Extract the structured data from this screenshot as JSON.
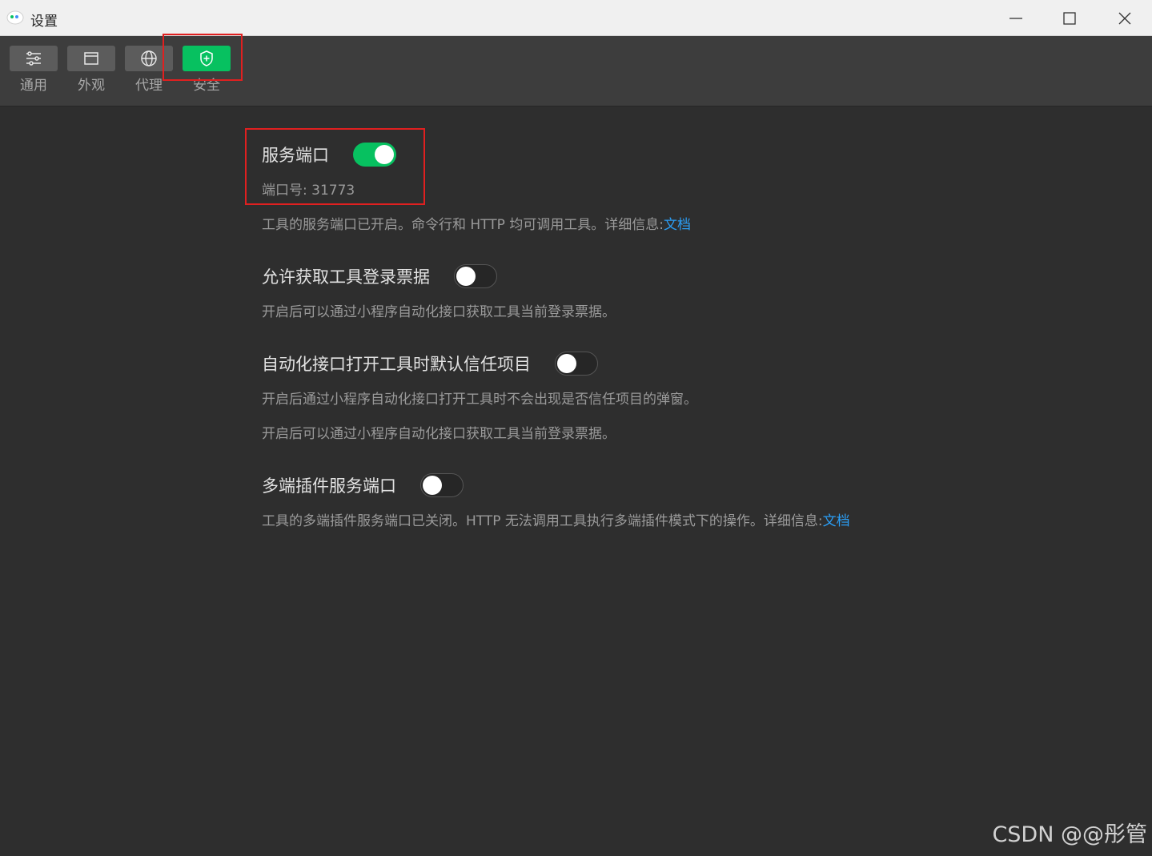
{
  "window": {
    "title": "设置"
  },
  "tabs": [
    {
      "label": "通用",
      "icon": "sliders-icon",
      "active": false
    },
    {
      "label": "外观",
      "icon": "window-icon",
      "active": false
    },
    {
      "label": "代理",
      "icon": "globe-icon",
      "active": false
    },
    {
      "label": "安全",
      "icon": "shield-plus-icon",
      "active": true
    }
  ],
  "settings": {
    "service_port": {
      "title": "服务端口",
      "enabled": true,
      "port_label": "端口号: 31773",
      "desc": "工具的服务端口已开启。命令行和 HTTP 均可调用工具。详细信息:",
      "link": "文档"
    },
    "login_ticket": {
      "title": "允许获取工具登录票据",
      "enabled": false,
      "desc": "开启后可以通过小程序自动化接口获取工具当前登录票据。"
    },
    "trust_project": {
      "title": "自动化接口打开工具时默认信任项目",
      "enabled": false,
      "desc1": "开启后通过小程序自动化接口打开工具时不会出现是否信任项目的弹窗。",
      "desc2": "开启后可以通过小程序自动化接口获取工具当前登录票据。"
    },
    "plugin_port": {
      "title": "多端插件服务端口",
      "enabled": false,
      "desc": "工具的多端插件服务端口已关闭。HTTP 无法调用工具执行多端插件模式下的操作。详细信息:",
      "link": "文档"
    }
  },
  "watermark": "CSDN @@彤管",
  "colors": {
    "accent": "#07c160",
    "link": "#2b9ef5",
    "highlight": "#e02020",
    "background": "#2e2e2e"
  }
}
